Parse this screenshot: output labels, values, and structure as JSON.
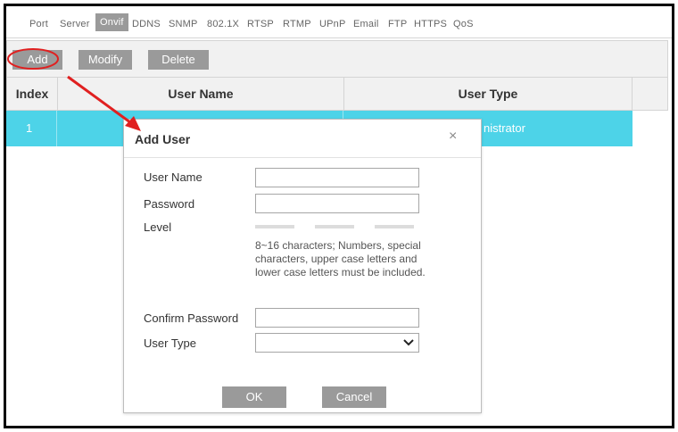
{
  "tabs": [
    "Port",
    "Server",
    "Onvif",
    "DDNS",
    "SNMP",
    "802.1X",
    "RTSP",
    "RTMP",
    "UPnP",
    "Email",
    "FTP",
    "HTTPS",
    "QoS"
  ],
  "active_tab": "Onvif",
  "toolbar": {
    "add": "Add",
    "modify": "Modify",
    "delete": "Delete"
  },
  "table": {
    "headers": [
      "Index",
      "User Name",
      "User Type"
    ],
    "rows": [
      {
        "index": "1",
        "user_name": "",
        "user_type": "nistrator"
      }
    ]
  },
  "dialog": {
    "title": "Add User",
    "close": "×",
    "user_name_label": "User Name",
    "password_label": "Password",
    "level_label": "Level",
    "hint": "8~16 characters; Numbers, special characters, upper case letters and lower case letters must be included.",
    "confirm_label": "Confirm Password",
    "user_type_label": "User Type",
    "user_name_value": "",
    "password_value": "",
    "confirm_value": "",
    "user_type_value": "",
    "ok": "OK",
    "cancel": "Cancel"
  },
  "colors": {
    "accent": "#4dd3e8",
    "button": "#9a9a9a",
    "annotation": "#e02020"
  },
  "icons": {
    "close": "close-icon",
    "dropdown": "chevron-down-icon",
    "annotation_arrow": "arrow-annotation-icon"
  }
}
